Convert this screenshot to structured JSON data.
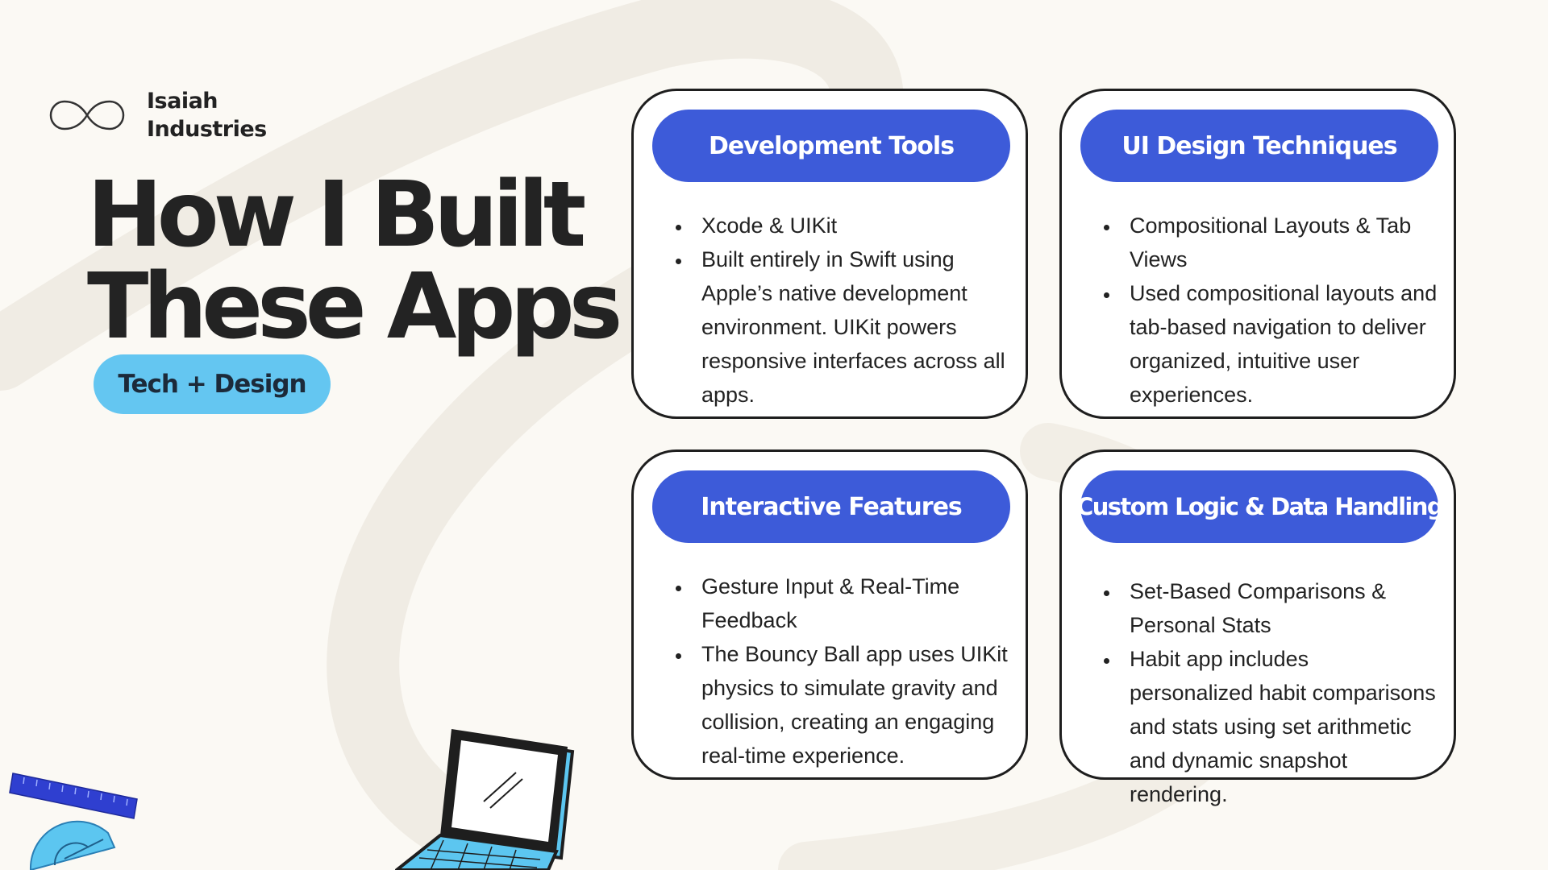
{
  "brand": {
    "name_line1": "Isaiah",
    "name_line2": "Industries",
    "logo_icon": "infinity-icon"
  },
  "title": {
    "line1": "How I Built",
    "line2": "These Apps"
  },
  "tag": "Tech + Design",
  "cards": [
    {
      "heading": "Development Tools",
      "bullets": [
        "Xcode & UIKit",
        "Built entirely in Swift using Apple’s native development environment. UIKit powers responsive interfaces across all apps."
      ]
    },
    {
      "heading": "UI Design Techniques",
      "bullets": [
        "Compositional Layouts & Tab Views",
        "Used compositional layouts and tab-based navigation to deliver organized, intuitive user experiences."
      ]
    },
    {
      "heading": "Interactive Features",
      "bullets": [
        "Gesture Input & Real-Time Feedback",
        "The Bouncy Ball app uses UIKit physics to simulate gravity and collision, creating an engaging real-time experience."
      ]
    },
    {
      "heading": "Custom Logic & Data Handling",
      "bullets": [
        "Set-Based Comparisons & Personal Stats",
        "Habit app includes personalized habit comparisons and stats using set arithmetic and dynamic snapshot rendering."
      ]
    }
  ],
  "decorations": {
    "ruler_icon": "ruler-icon",
    "protractor_icon": "protractor-icon",
    "laptop_icon": "laptop-icon"
  },
  "colors": {
    "background": "#fbf9f4",
    "card_header": "#3d5bd9",
    "tag_pill": "#64c6f1",
    "text": "#222222"
  }
}
